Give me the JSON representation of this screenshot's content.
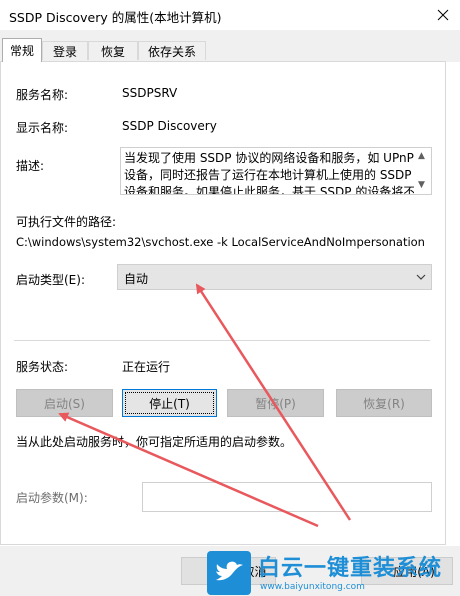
{
  "window": {
    "title": "SSDP Discovery 的属性(本地计算机)"
  },
  "tabs": [
    {
      "label": "常规",
      "active": true
    },
    {
      "label": "登录",
      "active": false
    },
    {
      "label": "恢复",
      "active": false
    },
    {
      "label": "依存关系",
      "active": false
    }
  ],
  "general": {
    "service_name_label": "服务名称:",
    "service_name": "SSDPSRV",
    "display_name_label": "显示名称:",
    "display_name": "SSDP Discovery",
    "description_label": "描述:",
    "description": "当发现了使用 SSDP 协议的网络设备和服务，如 UPnP 设备，同时还报告了运行在本地计算机上使用的 SSDP 设备和服务。如果停止此服务，基于 SSDP 的设备将不会被发现。",
    "exe_path_label": "可执行文件的路径:",
    "exe_path": "C:\\windows\\system32\\svchost.exe -k LocalServiceAndNoImpersonation",
    "startup_type_label": "启动类型(E):",
    "startup_type": "自动",
    "status_label": "服务状态:",
    "status": "正在运行",
    "buttons": {
      "start": "启动(S)",
      "stop": "停止(T)",
      "pause": "暂停(P)",
      "resume": "恢复(R)"
    },
    "hint": "当从此处启动服务时，你可指定所适用的启动参数。",
    "start_params_label": "启动参数(M):",
    "start_params_value": ""
  },
  "footer": {
    "cancel": "取消",
    "apply": "应用(A)"
  },
  "watermark": {
    "text": "白云一键重装系统",
    "url": "www.baiyunxitong.com"
  },
  "colors": {
    "annotation_arrow": "#e8585c",
    "watermark_blue": "#1e8fd6",
    "focus_border": "#0078d7"
  }
}
